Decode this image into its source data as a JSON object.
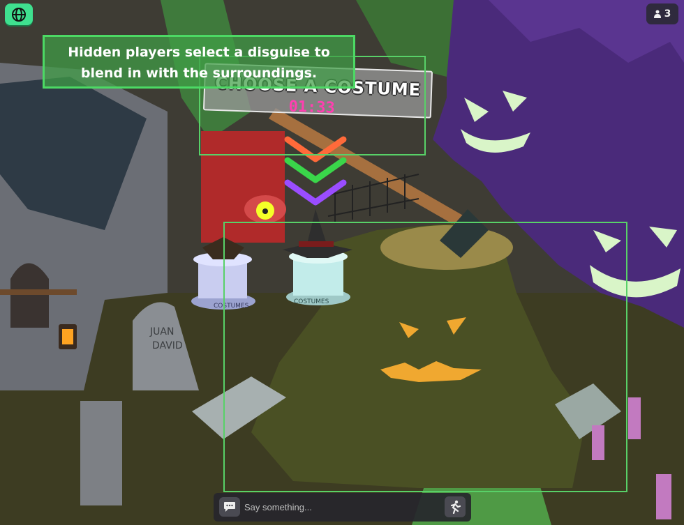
{
  "hud": {
    "player_count": "3",
    "globe_icon": "globe-icon",
    "player_icon": "person-icon"
  },
  "caption": {
    "line1": "Hidden players select a disguise to",
    "line2": "blend in with the surroundings."
  },
  "costume_panel": {
    "title": "CHOOSE A COSTUME",
    "timer": "01:33"
  },
  "pedestals": {
    "left_label": "COSTUMES",
    "right_label": "COSTUMES"
  },
  "gravestone": {
    "line1": "JUAN",
    "line2": "DAVID"
  },
  "chat": {
    "placeholder": "Say something...",
    "chat_icon": "chat-bubble-icon",
    "emote_icon": "running-person-icon"
  },
  "colors": {
    "highlight": "#58d168",
    "caption_bg": "#40a046",
    "timer": "#ff3fb0",
    "globe_button": "#3fe08f",
    "arrow_orange": "#ff6a3a",
    "arrow_green": "#3ad64a",
    "arrow_purple": "#9a4dff"
  }
}
